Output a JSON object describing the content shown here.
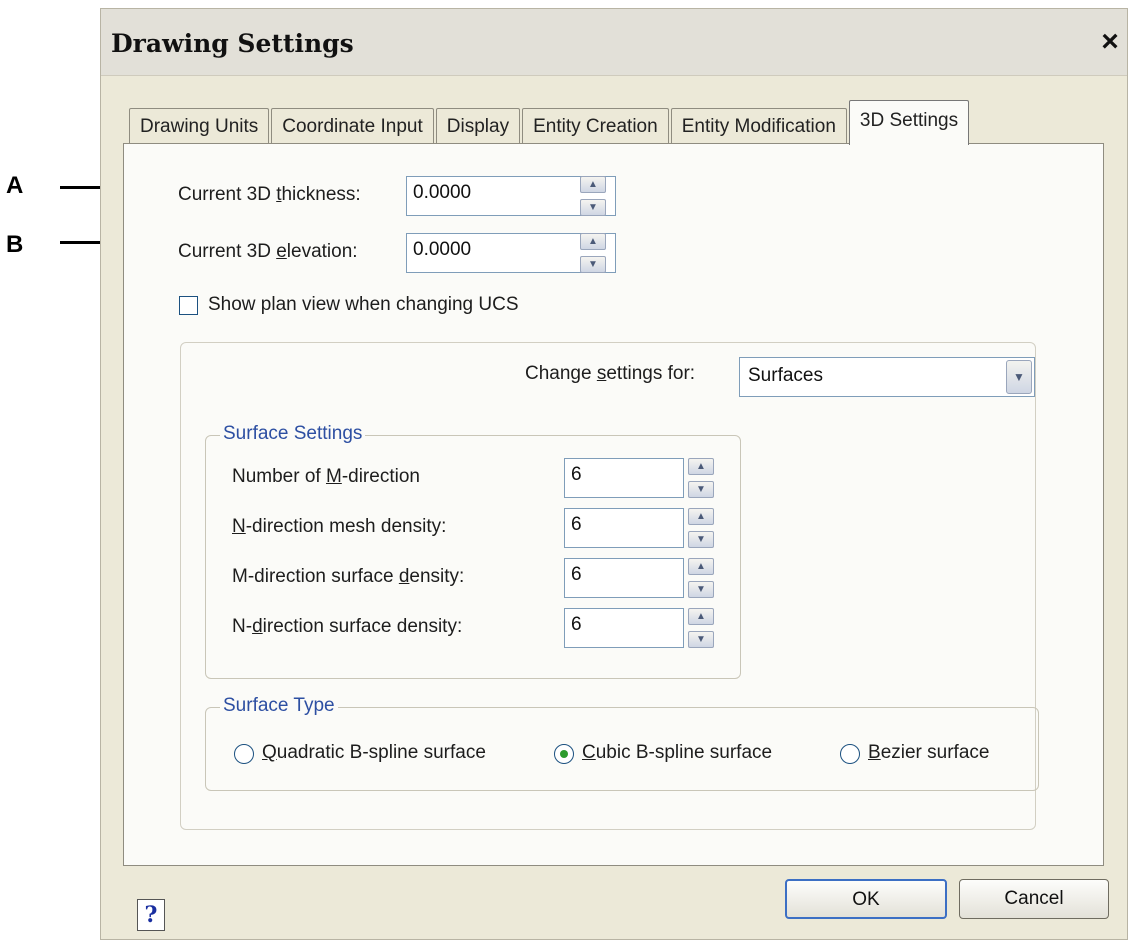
{
  "window": {
    "title": "Drawing Settings",
    "close_label": "×"
  },
  "tabs": [
    {
      "label": "Drawing Units",
      "active": false
    },
    {
      "label": "Coordinate Input",
      "active": false
    },
    {
      "label": "Display",
      "active": false
    },
    {
      "label": "Entity Creation",
      "active": false
    },
    {
      "label": "Entity Modification",
      "active": false
    },
    {
      "label": "3D Settings",
      "active": true
    }
  ],
  "fields": {
    "thickness": {
      "label_prefix": "Current 3D ",
      "label_u": "t",
      "label_suffix": "hickness:",
      "value": "0.0000"
    },
    "elevation": {
      "label_prefix": "Current 3D ",
      "label_u": "e",
      "label_suffix": "levation:",
      "value": "0.0000"
    }
  },
  "checkbox": {
    "label": "Show plan view when changing UCS",
    "checked": false
  },
  "change_settings": {
    "label_prefix": "Change ",
    "label_u": "s",
    "label_suffix": "ettings for:",
    "selected": "Surfaces"
  },
  "surface_settings": {
    "title": "Surface Settings",
    "rows": [
      {
        "pre": "Number of ",
        "u": "M",
        "post": "-direction",
        "value": "6"
      },
      {
        "pre": "",
        "u": "N",
        "post": "-direction mesh density:",
        "value": "6"
      },
      {
        "pre": "M-direction surface ",
        "u": "d",
        "post": "ensity:",
        "value": "6"
      },
      {
        "pre": "N-",
        "u": "d",
        "post": "irection surface density:",
        "value": "6"
      }
    ]
  },
  "surface_type": {
    "title": "Surface Type",
    "options": [
      {
        "u": "Q",
        "post": "uadratic B-spline surface",
        "checked": false
      },
      {
        "u": "C",
        "post": "ubic B-spline surface",
        "checked": true
      },
      {
        "u": "B",
        "post": "ezier surface",
        "checked": false
      }
    ]
  },
  "buttons": {
    "help": "?",
    "ok": "OK",
    "cancel": "Cancel"
  },
  "callouts": {
    "a": "A",
    "b": "B"
  }
}
